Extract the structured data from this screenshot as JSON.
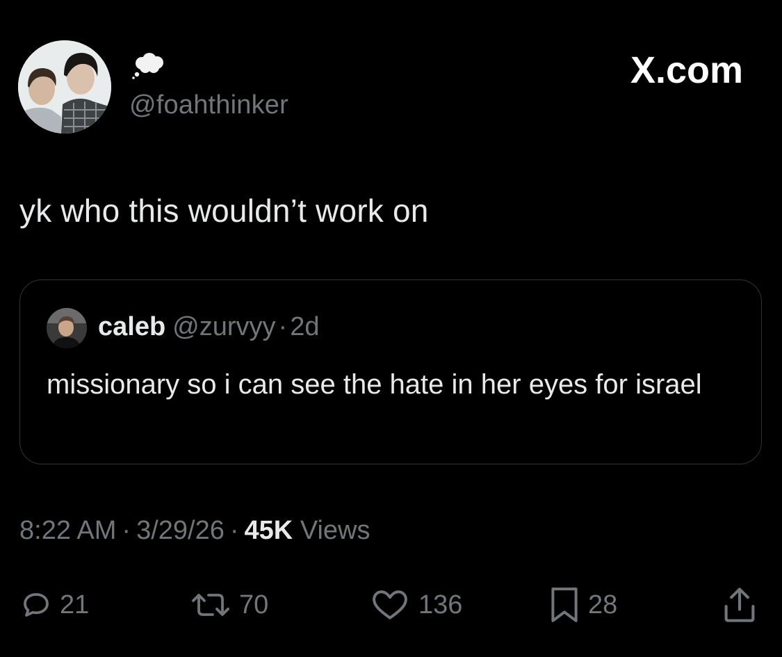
{
  "header": {
    "handle": "@foahthinker",
    "name_emoji": "thought-bubble-icon",
    "brand_text": "X.com"
  },
  "post": {
    "text": "yk who this wouldn’t work on"
  },
  "quote": {
    "name": "caleb",
    "handle": "@zurvyy",
    "separator": "·",
    "age": "2d",
    "text": "missionary so i can see the hate in her eyes for israel"
  },
  "meta": {
    "time": "8:22 AM",
    "separator": "·",
    "date": "3/29/26",
    "views_count": "45K",
    "views_label": "Views"
  },
  "actions": {
    "replies": "21",
    "reposts": "70",
    "likes": "136",
    "bookmarks": "28"
  },
  "colors": {
    "background": "#000000",
    "primary_text": "#e7e9ea",
    "secondary_text": "#71767b",
    "border": "#2f3336"
  }
}
